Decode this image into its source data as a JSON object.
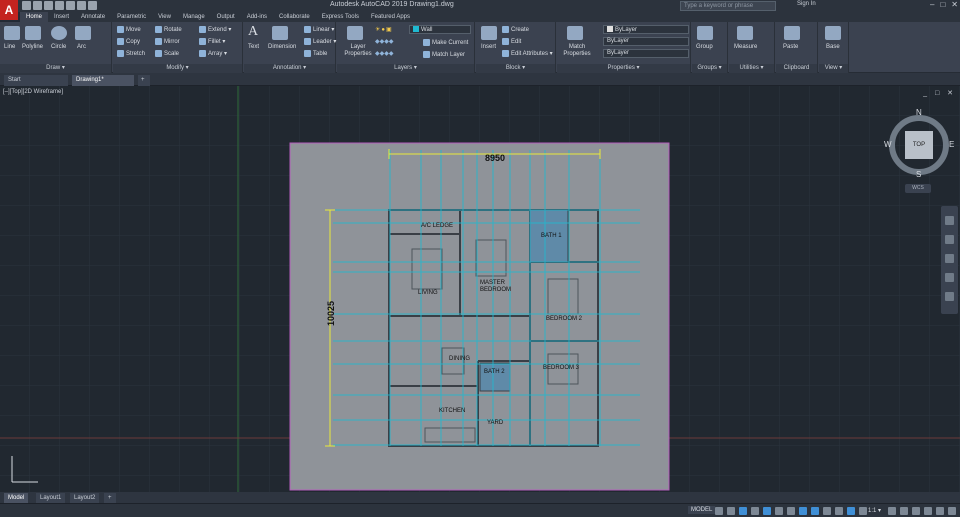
{
  "app": {
    "logo_letter": "A",
    "title": "Autodesk AutoCAD 2019   Drawing1.dwg",
    "search_placeholder": "Type a keyword or phrase",
    "signin": "Sign In",
    "window_controls": [
      "–",
      "□",
      "✕"
    ]
  },
  "ribbon_tabs": [
    "Home",
    "Insert",
    "Annotate",
    "Parametric",
    "View",
    "Manage",
    "Output",
    "Add-ins",
    "Collaborate",
    "Express Tools",
    "Featured Apps"
  ],
  "ribbon": {
    "draw": {
      "title": "Draw ▾",
      "line": "Line",
      "polyline": "Polyline",
      "circle": "Circle",
      "arc": "Arc"
    },
    "modify": {
      "title": "Modify ▾",
      "move": "Move",
      "rotate": "Rotate",
      "extend": "Extend ▾",
      "copy": "Copy",
      "mirror": "Mirror",
      "fillet": "Fillet ▾",
      "stretch": "Stretch",
      "scale": "Scale",
      "array": "Array ▾"
    },
    "annotation": {
      "title": "Annotation ▾",
      "text": "Text",
      "dimension": "Dimension",
      "linear": "Linear ▾",
      "leader": "Leader ▾",
      "table": "Table"
    },
    "layers": {
      "title": "Layers ▾",
      "layer_properties": "Layer Properties",
      "current_layer": "Wall",
      "make_current": "Make Current",
      "match_layer": "Match Layer"
    },
    "block": {
      "title": "Block ▾",
      "insert": "Insert",
      "create": "Create",
      "edit": "Edit",
      "edit_attributes": "Edit Attributes ▾"
    },
    "properties": {
      "title": "Properties ▾",
      "match_properties": "Match Properties",
      "color": "ByLayer",
      "linetype": "ByLayer",
      "lineweight": "ByLayer"
    },
    "groups": {
      "title": "Groups ▾",
      "group": "Group"
    },
    "utilities": {
      "title": "Utilities ▾",
      "measure": "Measure"
    },
    "clipboard": {
      "title": "Clipboard",
      "paste": "Paste"
    },
    "view": {
      "title": "View ▾",
      "base": "Base"
    }
  },
  "file_tabs": [
    "Start",
    "Drawing1*",
    "+"
  ],
  "viewport": {
    "label": "[–][Top][2D Wireframe]",
    "controls": "_ □ ✕",
    "viewcube": {
      "face": "TOP",
      "n": "N",
      "s": "S",
      "e": "E",
      "w": "W"
    },
    "wcs": "WCS"
  },
  "plan": {
    "dim_width": "8950",
    "dim_height": "10025",
    "rooms": [
      "A/C LEDGE",
      "BATH 1",
      "LIVING",
      "MASTER BEDROOM",
      "BEDROOM 2",
      "DINING",
      "BATH 2",
      "BEDROOM 3",
      "KITCHEN",
      "YARD"
    ]
  },
  "layout_tabs": [
    "Model",
    "Layout1",
    "Layout2",
    "+"
  ],
  "status": {
    "model": "MODEL",
    "scale": "1:1 ▾"
  },
  "colors": {
    "accent": "#3f8fd6",
    "grid_line": "#1fb9d1",
    "paper": "#8f9399",
    "dim": "#e8ea3a"
  }
}
